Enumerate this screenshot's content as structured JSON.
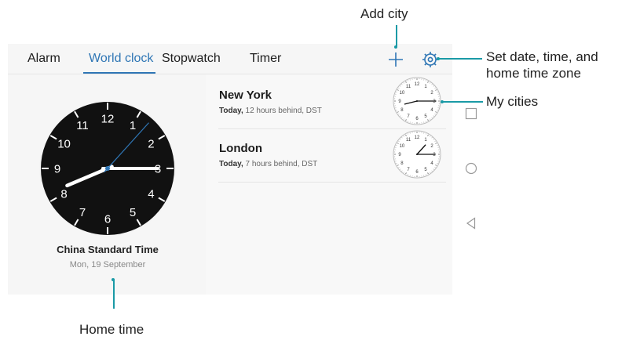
{
  "tabs": [
    {
      "label": "Alarm"
    },
    {
      "label": "World clock",
      "active": true
    },
    {
      "label": "Stopwatch"
    },
    {
      "label": "Timer"
    }
  ],
  "toolbar": {
    "add_icon": "plus-icon",
    "settings_icon": "gear-icon"
  },
  "home_clock": {
    "time_zone": "China Standard Time",
    "date": "Mon, 19 September",
    "numerals": [
      "12",
      "1",
      "2",
      "3",
      "4",
      "5",
      "6",
      "7",
      "8",
      "9",
      "10",
      "11"
    ]
  },
  "cities": [
    {
      "name": "New York",
      "day": "Today,",
      "offset": "12 hours behind, DST"
    },
    {
      "name": "London",
      "day": "Today,",
      "offset": "7 hours behind, DST"
    }
  ],
  "navbar": {
    "icons": [
      "recent-apps-square-icon",
      "home-circle-icon",
      "back-triangle-icon"
    ]
  },
  "annotations": {
    "add_city": "Add city",
    "set_date_line1": "Set date, time, and",
    "set_date_line2": "home time zone",
    "my_cities": "My cities",
    "home_time": "Home time"
  },
  "colors": {
    "accent": "#2f76b5",
    "leader": "#1a9aa6",
    "clock_face": "#111111"
  }
}
